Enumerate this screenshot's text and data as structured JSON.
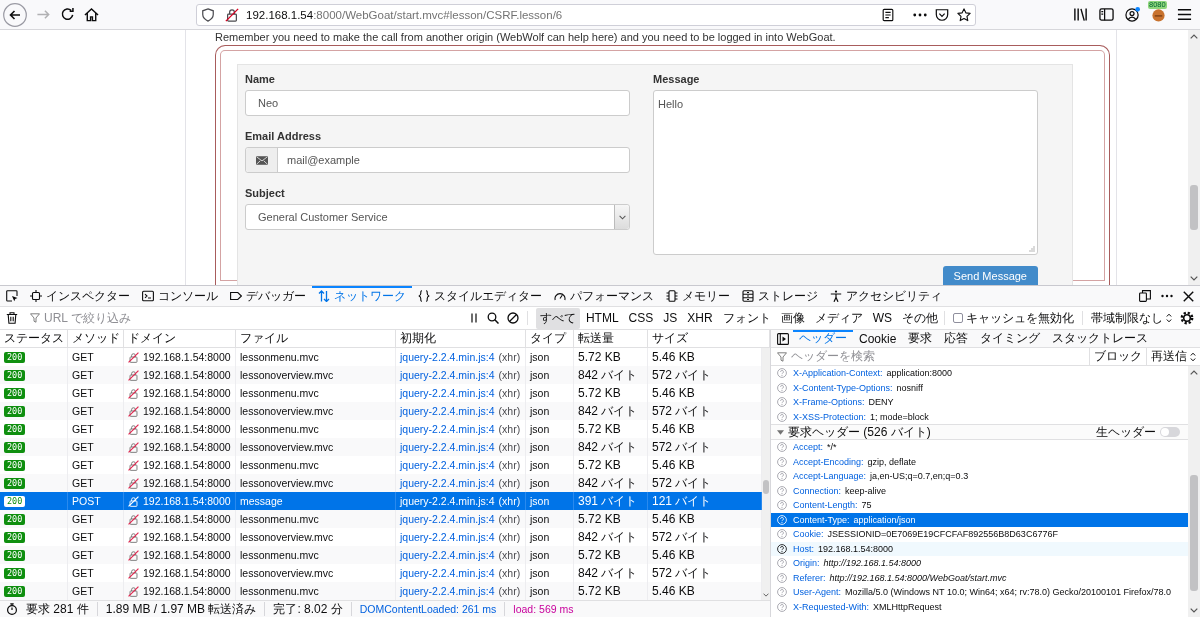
{
  "browser": {
    "forward_disabled": true,
    "url": {
      "host": "192.168.1.54",
      "rest": ":8000/WebGoat/start.mvc#lesson/CSRF.lesson/6"
    },
    "extension_badge": "8080"
  },
  "page": {
    "notice": "Remember you need to make the call from another origin (WebWolf can help here) and you need to be logged in into WebGoat.",
    "form": {
      "name": {
        "label": "Name",
        "value": "Neo"
      },
      "email": {
        "label": "Email Address",
        "value": "mail@example"
      },
      "subject": {
        "label": "Subject",
        "value": "General Customer Service"
      },
      "message": {
        "label": "Message",
        "value": "Hello"
      },
      "submit": "Send Message"
    }
  },
  "devtools": {
    "tabs": [
      {
        "label": "インスペクター",
        "selected": false
      },
      {
        "label": "コンソール",
        "selected": false
      },
      {
        "label": "デバッガー",
        "selected": false
      },
      {
        "label": "ネットワーク",
        "selected": true
      },
      {
        "label": "スタイルエディター",
        "selected": false
      },
      {
        "label": "パフォーマンス",
        "selected": false
      },
      {
        "label": "メモリー",
        "selected": false
      },
      {
        "label": "ストレージ",
        "selected": false
      },
      {
        "label": "アクセシビリティ",
        "selected": false
      }
    ],
    "url_filter": {
      "placeholder": "URL で絞り込み"
    },
    "type_filters": [
      {
        "label": "すべて",
        "selected": true
      },
      {
        "label": "HTML",
        "selected": false
      },
      {
        "label": "CSS",
        "selected": false
      },
      {
        "label": "JS",
        "selected": false
      },
      {
        "label": "XHR",
        "selected": false
      },
      {
        "label": "フォント",
        "selected": false
      },
      {
        "label": "画像",
        "selected": false
      },
      {
        "label": "メディア",
        "selected": false
      },
      {
        "label": "WS",
        "selected": false
      },
      {
        "label": "その他",
        "selected": false
      }
    ],
    "disable_cache": {
      "label": "キャッシュを無効化",
      "checked": false
    },
    "throttling": "帯域制限なし",
    "network": {
      "columns": [
        "ステータス",
        "メソッド",
        "ドメイン",
        "ファイル",
        "初期化",
        "タイプ",
        "転送量",
        "サイズ"
      ],
      "rows": [
        {
          "status": "200",
          "method": "GET",
          "domain": "192.168.1.54:8000",
          "file": "lessonmenu.mvc",
          "initiator": "jquery-2.2.4.min.js:4",
          "cause": "(xhr)",
          "type": "json",
          "transferred": "5.72 KB",
          "size": "5.46 KB",
          "selected": false
        },
        {
          "status": "200",
          "method": "GET",
          "domain": "192.168.1.54:8000",
          "file": "lessonoverview.mvc",
          "initiator": "jquery-2.2.4.min.js:4",
          "cause": "(xhr)",
          "type": "json",
          "transferred": "842 バイト",
          "size": "572 バイト",
          "selected": false
        },
        {
          "status": "200",
          "method": "GET",
          "domain": "192.168.1.54:8000",
          "file": "lessonmenu.mvc",
          "initiator": "jquery-2.2.4.min.js:4",
          "cause": "(xhr)",
          "type": "json",
          "transferred": "5.72 KB",
          "size": "5.46 KB",
          "selected": false
        },
        {
          "status": "200",
          "method": "GET",
          "domain": "192.168.1.54:8000",
          "file": "lessonoverview.mvc",
          "initiator": "jquery-2.2.4.min.js:4",
          "cause": "(xhr)",
          "type": "json",
          "transferred": "842 バイト",
          "size": "572 バイト",
          "selected": false
        },
        {
          "status": "200",
          "method": "GET",
          "domain": "192.168.1.54:8000",
          "file": "lessonmenu.mvc",
          "initiator": "jquery-2.2.4.min.js:4",
          "cause": "(xhr)",
          "type": "json",
          "transferred": "5.72 KB",
          "size": "5.46 KB",
          "selected": false
        },
        {
          "status": "200",
          "method": "GET",
          "domain": "192.168.1.54:8000",
          "file": "lessonoverview.mvc",
          "initiator": "jquery-2.2.4.min.js:4",
          "cause": "(xhr)",
          "type": "json",
          "transferred": "842 バイト",
          "size": "572 バイト",
          "selected": false
        },
        {
          "status": "200",
          "method": "GET",
          "domain": "192.168.1.54:8000",
          "file": "lessonmenu.mvc",
          "initiator": "jquery-2.2.4.min.js:4",
          "cause": "(xhr)",
          "type": "json",
          "transferred": "5.72 KB",
          "size": "5.46 KB",
          "selected": false
        },
        {
          "status": "200",
          "method": "GET",
          "domain": "192.168.1.54:8000",
          "file": "lessonoverview.mvc",
          "initiator": "jquery-2.2.4.min.js:4",
          "cause": "(xhr)",
          "type": "json",
          "transferred": "842 バイト",
          "size": "572 バイト",
          "selected": false
        },
        {
          "status": "200",
          "method": "POST",
          "domain": "192.168.1.54:8000",
          "file": "message",
          "initiator": "jquery-2.2.4.min.js:4",
          "cause": "(xhr)",
          "type": "json",
          "transferred": "391 バイト",
          "size": "121 バイト",
          "selected": true
        },
        {
          "status": "200",
          "method": "GET",
          "domain": "192.168.1.54:8000",
          "file": "lessonmenu.mvc",
          "initiator": "jquery-2.2.4.min.js:4",
          "cause": "(xhr)",
          "type": "json",
          "transferred": "5.72 KB",
          "size": "5.46 KB",
          "selected": false
        },
        {
          "status": "200",
          "method": "GET",
          "domain": "192.168.1.54:8000",
          "file": "lessonoverview.mvc",
          "initiator": "jquery-2.2.4.min.js:4",
          "cause": "(xhr)",
          "type": "json",
          "transferred": "842 バイト",
          "size": "572 バイト",
          "selected": false
        },
        {
          "status": "200",
          "method": "GET",
          "domain": "192.168.1.54:8000",
          "file": "lessonmenu.mvc",
          "initiator": "jquery-2.2.4.min.js:4",
          "cause": "(xhr)",
          "type": "json",
          "transferred": "5.72 KB",
          "size": "5.46 KB",
          "selected": false
        },
        {
          "status": "200",
          "method": "GET",
          "domain": "192.168.1.54:8000",
          "file": "lessonoverview.mvc",
          "initiator": "jquery-2.2.4.min.js:4",
          "cause": "(xhr)",
          "type": "json",
          "transferred": "842 バイト",
          "size": "572 バイト",
          "selected": false
        },
        {
          "status": "200",
          "method": "GET",
          "domain": "192.168.1.54:8000",
          "file": "lessonmenu.mvc",
          "initiator": "jquery-2.2.4.min.js:4",
          "cause": "(xhr)",
          "type": "json",
          "transferred": "5.72 KB",
          "size": "5.46 KB",
          "selected": false
        }
      ]
    },
    "status_bar": {
      "requests": "要求 281 件",
      "transferred": "1.89 MB / 1.97 MB 転送済み",
      "finish": "完了: 8.02 分",
      "dom_content_loaded": "DOMContentLoaded: 261 ms",
      "load": "load: 569 ms"
    },
    "details": {
      "tabs": [
        {
          "label": "ヘッダー",
          "selected": true
        },
        {
          "label": "Cookie",
          "selected": false
        },
        {
          "label": "要求",
          "selected": false
        },
        {
          "label": "応答",
          "selected": false
        },
        {
          "label": "タイミング",
          "selected": false
        },
        {
          "label": "スタックトレース",
          "selected": false
        }
      ],
      "filter": {
        "placeholder": "ヘッダーを検索"
      },
      "block": "ブロック",
      "resend": "再送信",
      "response_headers": [
        {
          "name": "X-Application-Context:",
          "value": "application:8000",
          "kind": "text",
          "selected": false,
          "hovered": false
        },
        {
          "name": "X-Content-Type-Options:",
          "value": "nosniff",
          "kind": "text",
          "selected": false,
          "hovered": false
        },
        {
          "name": "X-Frame-Options:",
          "value": "DENY",
          "kind": "text",
          "selected": false,
          "hovered": false
        },
        {
          "name": "X-XSS-Protection:",
          "value": "1; mode=block",
          "kind": "text",
          "selected": false,
          "hovered": false
        }
      ],
      "request_section": {
        "title": "要求ヘッダー (526 バイト)",
        "expanded": true,
        "raw_label": "生ヘッダー",
        "raw_on": false
      },
      "request_headers": [
        {
          "name": "Accept:",
          "value": "*/*",
          "kind": "text",
          "selected": false,
          "hovered": false
        },
        {
          "name": "Accept-Encoding:",
          "value": "gzip, deflate",
          "kind": "text",
          "selected": false,
          "hovered": false
        },
        {
          "name": "Accept-Language:",
          "value": "ja,en-US;q=0.7,en;q=0.3",
          "kind": "text",
          "selected": false,
          "hovered": false
        },
        {
          "name": "Connection:",
          "value": "keep-alive",
          "kind": "text",
          "selected": false,
          "hovered": false
        },
        {
          "name": "Content-Length:",
          "value": "75",
          "kind": "text",
          "selected": false,
          "hovered": false
        },
        {
          "name": "Content-Type:",
          "value": "application/json",
          "kind": "text",
          "selected": true,
          "hovered": false
        },
        {
          "name": "Cookie:",
          "value": "JSESSIONID=0E7069E19CFCFAF892556B8D63C6776F",
          "kind": "text",
          "selected": false,
          "hovered": false
        },
        {
          "name": "Host:",
          "value": "192.168.1.54:8000",
          "kind": "text",
          "selected": false,
          "hovered": true
        },
        {
          "name": "Origin:",
          "value": "http://192.168.1.54:8000",
          "kind": "url",
          "selected": false,
          "hovered": false
        },
        {
          "name": "Referer:",
          "value": "http://192.168.1.54:8000/WebGoat/start.mvc",
          "kind": "url",
          "selected": false,
          "hovered": false
        },
        {
          "name": "User-Agent:",
          "value": "Mozilla/5.0 (Windows NT 10.0; Win64; x64; rv:78.0) Gecko/20100101 Firefox/78.0",
          "kind": "text",
          "selected": false,
          "hovered": false
        },
        {
          "name": "X-Requested-With:",
          "value": "XMLHttpRequest",
          "kind": "text",
          "selected": false,
          "hovered": false
        }
      ]
    }
  }
}
